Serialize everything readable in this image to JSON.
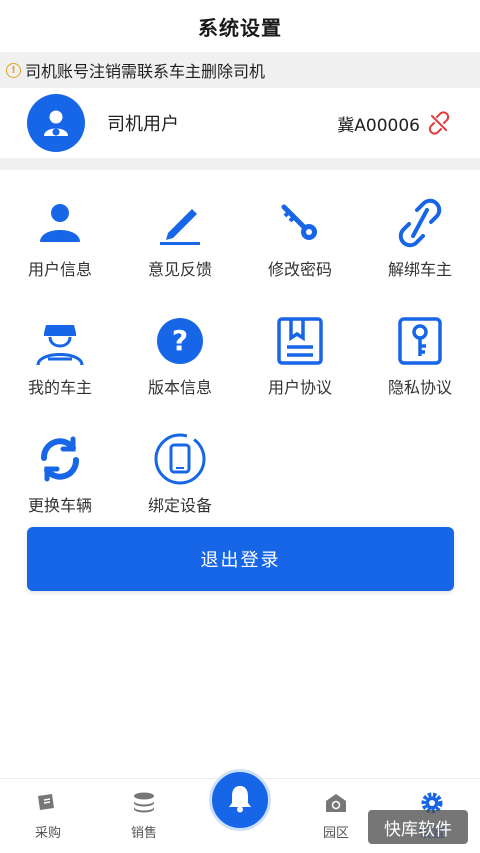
{
  "header": {
    "title": "系统设置"
  },
  "notice": {
    "icon": "warning-icon",
    "text": "司机账号注销需联系车主删除司机",
    "color": "#e3a320"
  },
  "profile": {
    "name": "司机用户",
    "plate": "冀A00006",
    "avatar_icon": "driver-avatar-icon",
    "unlink_icon": "unlink-icon"
  },
  "grid": {
    "items": [
      {
        "label": "用户信息",
        "icon": "user-icon"
      },
      {
        "label": "意见反馈",
        "icon": "pencil-icon"
      },
      {
        "label": "修改密码",
        "icon": "key-icon"
      },
      {
        "label": "解绑车主",
        "icon": "unlink-icon"
      },
      {
        "label": "我的车主",
        "icon": "driver-icon"
      },
      {
        "label": "版本信息",
        "icon": "question-icon"
      },
      {
        "label": "用户协议",
        "icon": "bookmark-document-icon"
      },
      {
        "label": "隐私协议",
        "icon": "key-card-icon"
      },
      {
        "label": "更换车辆",
        "icon": "refresh-icon"
      },
      {
        "label": "绑定设备",
        "icon": "tablet-icon"
      }
    ]
  },
  "logout": {
    "label": "退出登录"
  },
  "tabbar": {
    "items": [
      {
        "label": "采购",
        "icon": "purchase-icon"
      },
      {
        "label": "销售",
        "icon": "coins-icon"
      },
      {
        "label": "",
        "icon": "bell-icon"
      },
      {
        "label": "园区",
        "icon": "park-icon"
      },
      {
        "label": "设置",
        "icon": "gear-icon"
      }
    ]
  },
  "watermark": {
    "text": "快库软件"
  },
  "colors": {
    "accent": "#1766e8",
    "unlink": "#e23b3b"
  }
}
